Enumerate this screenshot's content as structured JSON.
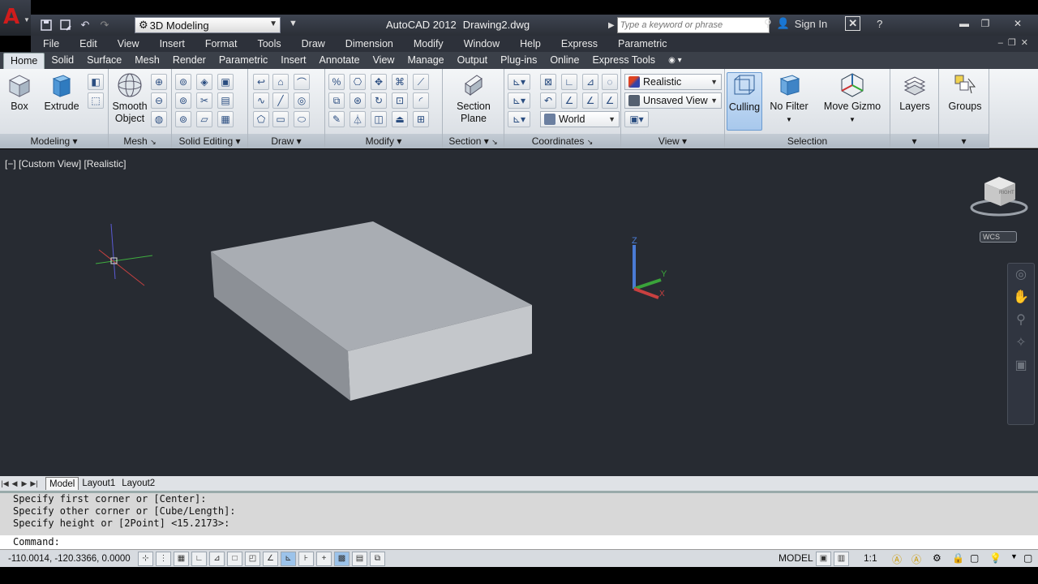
{
  "app": {
    "title": "AutoCAD 2012",
    "document": "Drawing2.dwg"
  },
  "workspace": "3D Modeling",
  "search": {
    "placeholder": "Type a keyword or phrase"
  },
  "sign_in": "Sign In",
  "menus": [
    "File",
    "Edit",
    "View",
    "Insert",
    "Format",
    "Tools",
    "Draw",
    "Dimension",
    "Modify",
    "Window",
    "Help",
    "Express",
    "Parametric"
  ],
  "tabs": [
    "Home",
    "Solid",
    "Surface",
    "Mesh",
    "Render",
    "Parametric",
    "Insert",
    "Annotate",
    "View",
    "Manage",
    "Output",
    "Plug-ins",
    "Online",
    "Express Tools"
  ],
  "ribbon": {
    "modeling": {
      "title": "Modeling",
      "box": "Box",
      "extrude": "Extrude"
    },
    "mesh": {
      "title": "Mesh",
      "smooth1": "Smooth",
      "smooth2": "Object"
    },
    "solid_editing": {
      "title": "Solid Editing"
    },
    "draw": {
      "title": "Draw"
    },
    "modify": {
      "title": "Modify"
    },
    "section": {
      "title": "Section",
      "plane1": "Section",
      "plane2": "Plane"
    },
    "coordinates": {
      "title": "Coordinates",
      "ucs": "World"
    },
    "view": {
      "title": "View",
      "visual_style": "Realistic",
      "named_view": "Unsaved View"
    },
    "selection": {
      "title": "Selection",
      "culling": "Culling",
      "filter": "No Filter",
      "gizmo": "Move Gizmo"
    },
    "layers": "Layers",
    "groups": "Groups"
  },
  "viewport": {
    "label": "[−] [Custom View] [Realistic]",
    "wcs": "WCS",
    "cube_face": "RIGHT"
  },
  "layout_tabs": [
    "Model",
    "Layout1",
    "Layout2"
  ],
  "command_history": [
    "Specify first corner or [Center]:",
    "Specify other corner or [Cube/Length]:",
    "Specify height or [2Point] <15.2173>:"
  ],
  "command_prompt": "Command:",
  "status": {
    "coords": "-110.0014, -120.3366, 0.0000",
    "model": "MODEL",
    "scale": "1:1"
  }
}
